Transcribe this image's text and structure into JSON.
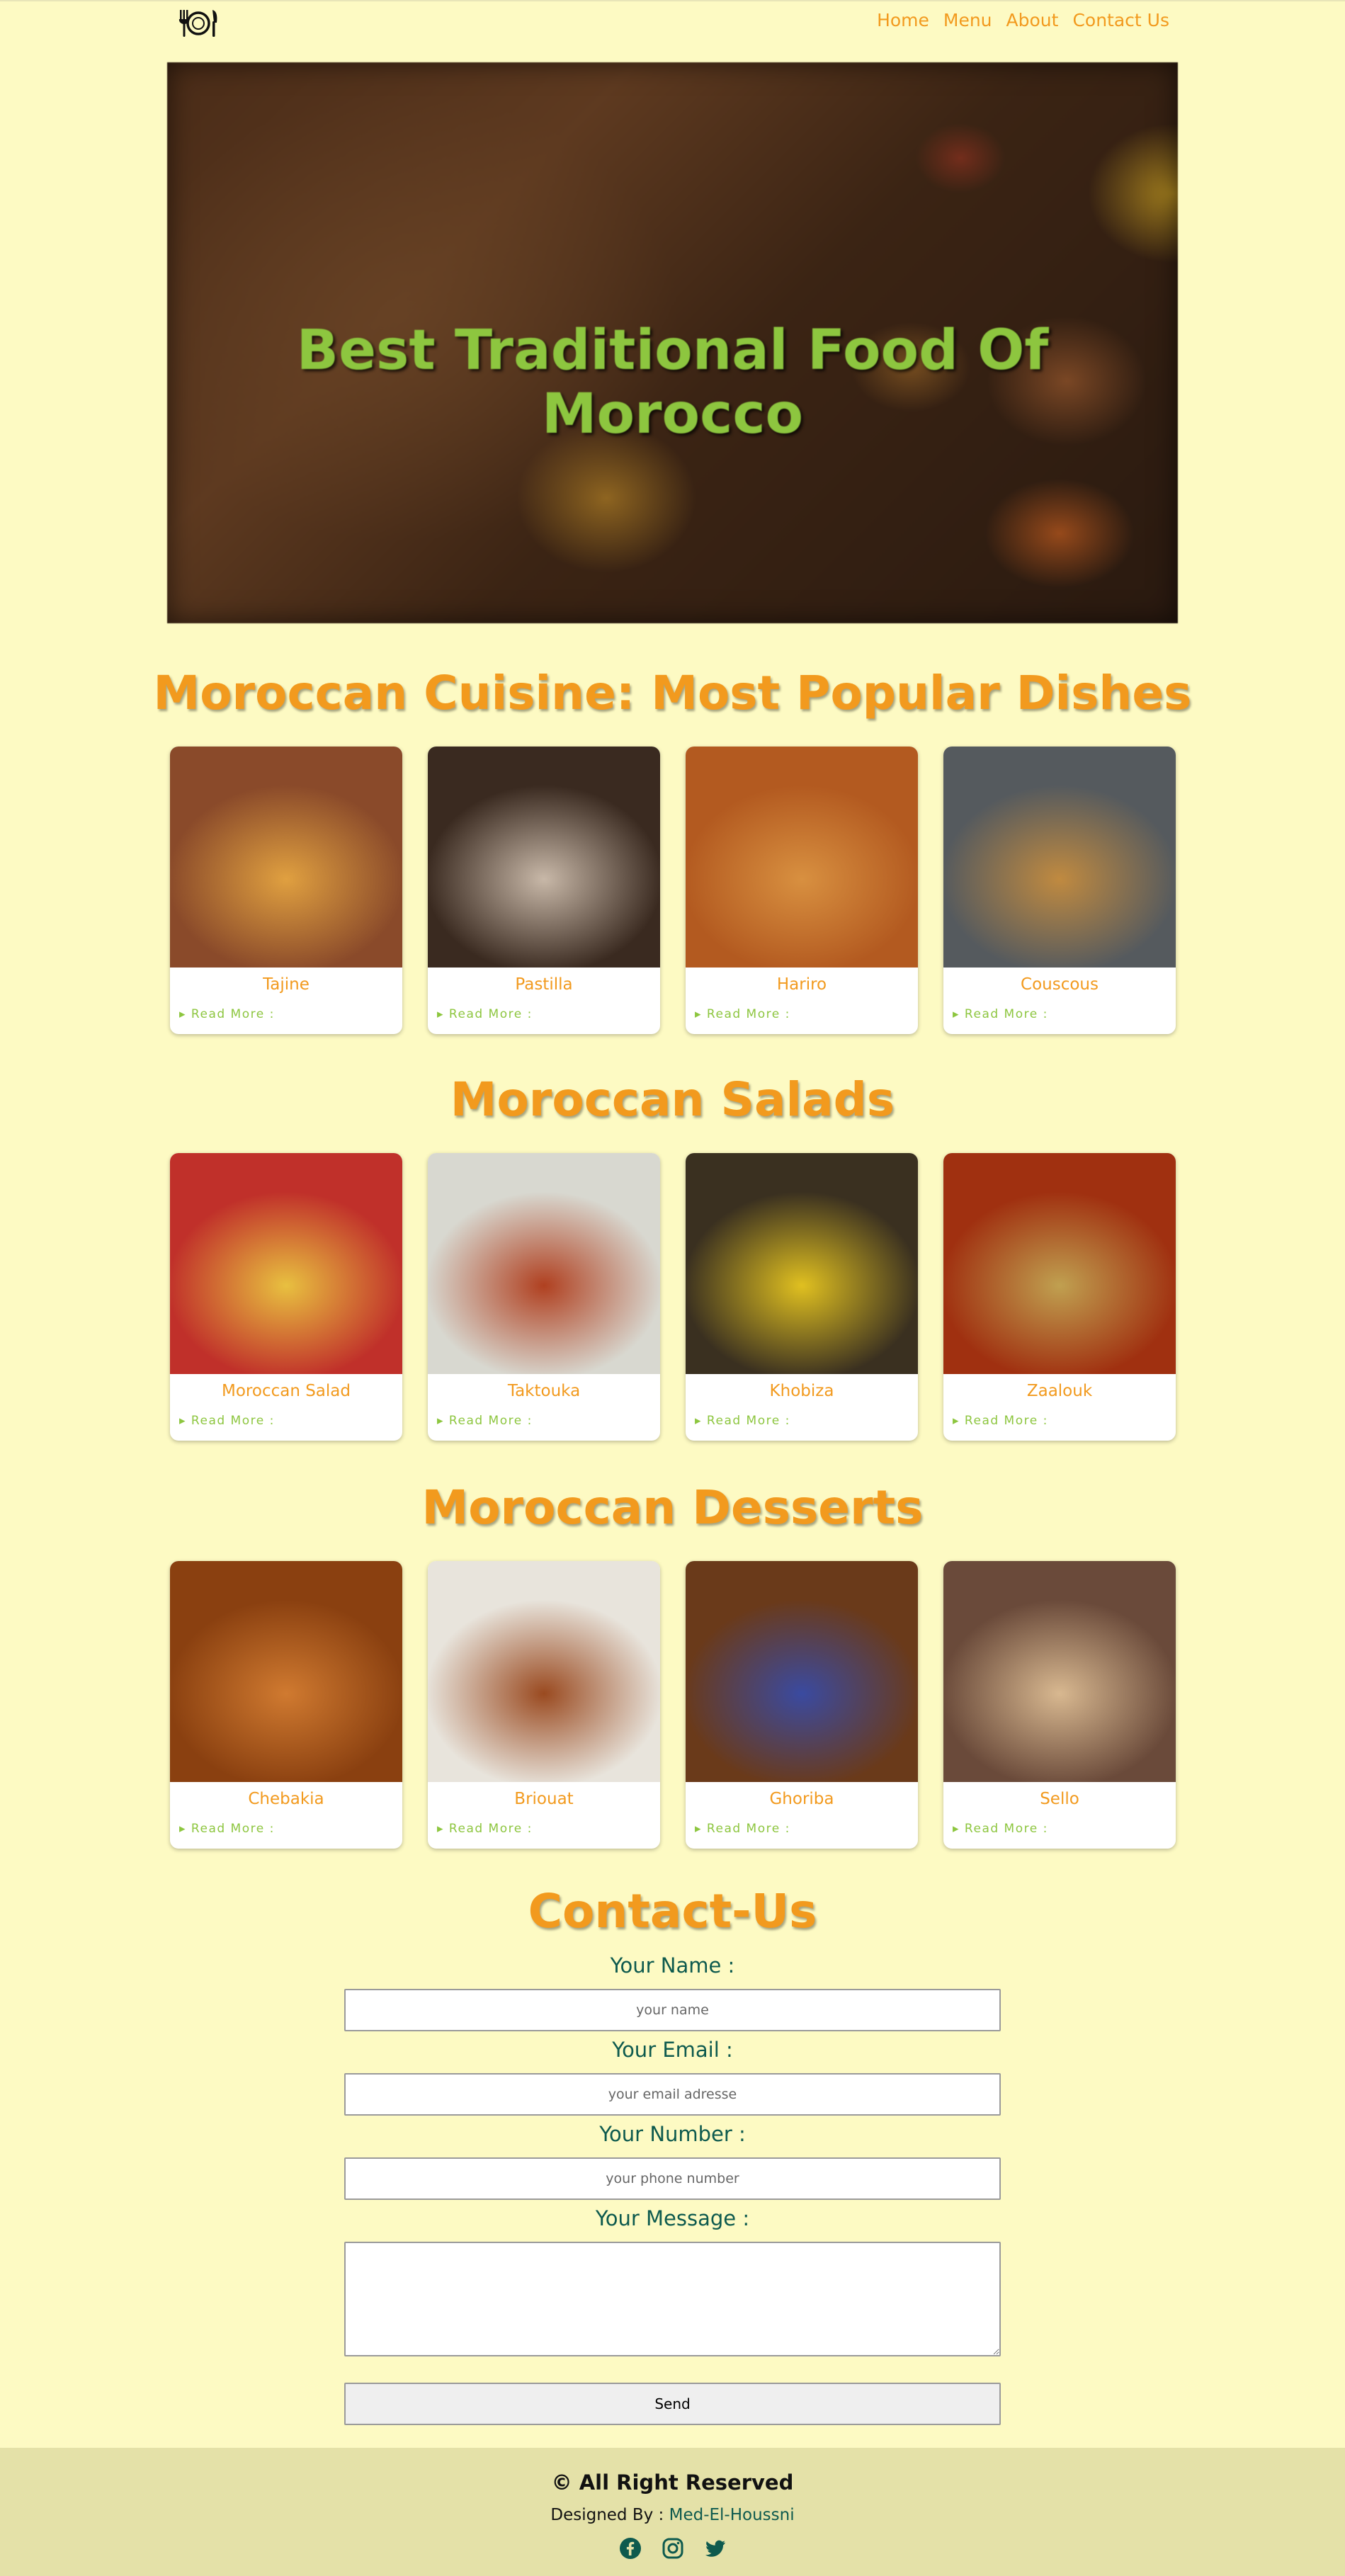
{
  "nav": {
    "links": [
      "Home",
      "Menu",
      "About",
      "Contact Us"
    ]
  },
  "hero": {
    "title": "Best Traditional Food Of Morocco"
  },
  "sections": [
    {
      "title": "Moroccan Cuisine: Most Popular Dishes",
      "cards": [
        {
          "name": "Tajine",
          "more": "▸ Read More :",
          "colors": [
            "#8a4a2a",
            "#e0a040"
          ]
        },
        {
          "name": "Pastilla",
          "more": "▸ Read More :",
          "colors": [
            "#3a2a20",
            "#c8b8a8"
          ]
        },
        {
          "name": "Hariro",
          "more": "▸ Read More :",
          "colors": [
            "#b35a20",
            "#d89040"
          ]
        },
        {
          "name": "Couscous",
          "more": "▸ Read More :",
          "colors": [
            "#555a5e",
            "#c08a40"
          ]
        }
      ]
    },
    {
      "title": "Moroccan Salads",
      "cards": [
        {
          "name": "Moroccan Salad",
          "more": "▸ Read More :",
          "colors": [
            "#c0302a",
            "#e8c040"
          ]
        },
        {
          "name": "Taktouka",
          "more": "▸ Read More :",
          "colors": [
            "#d8d8d0",
            "#b04020"
          ]
        },
        {
          "name": "Khobiza",
          "more": "▸ Read More :",
          "colors": [
            "#3a3020",
            "#e0c020"
          ]
        },
        {
          "name": "Zaalouk",
          "more": "▸ Read More :",
          "colors": [
            "#a03010",
            "#c0a050"
          ]
        }
      ]
    },
    {
      "title": "Moroccan Desserts",
      "cards": [
        {
          "name": "Chebakia",
          "more": "▸ Read More :",
          "colors": [
            "#8a4010",
            "#d07a30"
          ]
        },
        {
          "name": "Briouat",
          "more": "▸ Read More :",
          "colors": [
            "#e8e4dc",
            "#9a4a20"
          ]
        },
        {
          "name": "Ghoriba",
          "more": "▸ Read More :",
          "colors": [
            "#6a3a1a",
            "#3a4aa0"
          ]
        },
        {
          "name": "Sello",
          "more": "▸ Read More :",
          "colors": [
            "#6a4a3a",
            "#d8b890"
          ]
        }
      ]
    }
  ],
  "contact": {
    "title": "Contact-Us",
    "name_label": "Your Name :",
    "name_placeholder": "your name",
    "email_label": "Your Email :",
    "email_placeholder": "your email adresse",
    "number_label": "Your Number :",
    "number_placeholder": "your phone number",
    "message_label": "Your Message :",
    "send_label": "Send"
  },
  "footer": {
    "rights": "© All Right Reserved",
    "designed_by": "Designed By :",
    "author": "Med-El-Houssni",
    "socials": [
      "facebook-icon",
      "instagram-icon",
      "twitter-icon"
    ]
  }
}
